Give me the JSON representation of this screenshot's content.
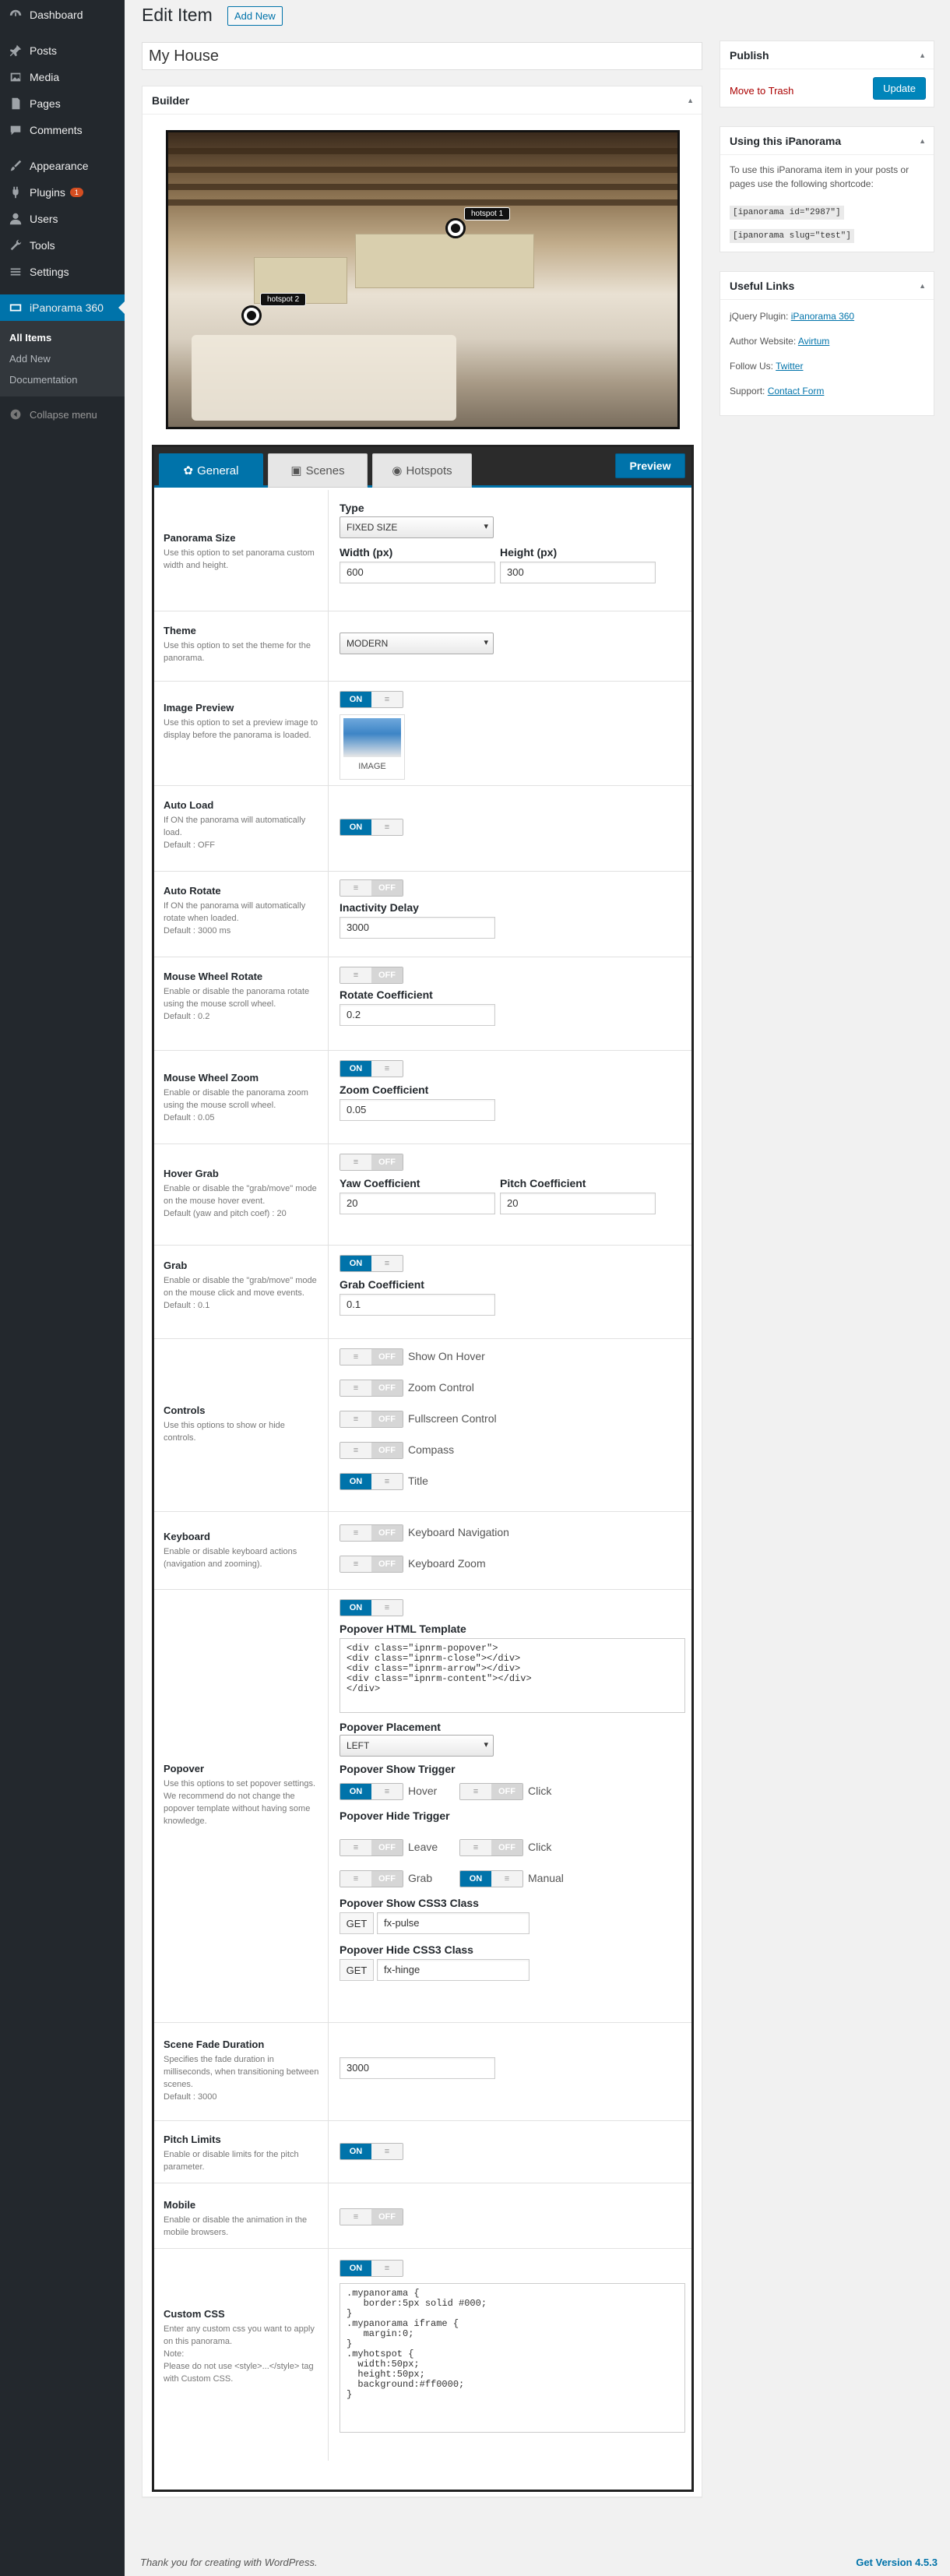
{
  "sidebar": {
    "items": [
      {
        "label": "Dashboard",
        "icon": "dashboard-icon"
      },
      {
        "label": "Posts",
        "icon": "pin-icon"
      },
      {
        "label": "Media",
        "icon": "media-icon"
      },
      {
        "label": "Pages",
        "icon": "page-icon"
      },
      {
        "label": "Comments",
        "icon": "comment-icon"
      },
      {
        "label": "Appearance",
        "icon": "brush-icon"
      },
      {
        "label": "Plugins",
        "icon": "plugin-icon",
        "badge": "1"
      },
      {
        "label": "Users",
        "icon": "user-icon"
      },
      {
        "label": "Tools",
        "icon": "wrench-icon"
      },
      {
        "label": "Settings",
        "icon": "settings-icon"
      },
      {
        "label": "iPanorama 360",
        "icon": "panorama-icon"
      }
    ],
    "submenu": [
      "All Items",
      "Add New",
      "Documentation"
    ],
    "collapse": "Collapse menu"
  },
  "header": {
    "title": "Edit Item",
    "add_new": "Add New"
  },
  "post_title": "My House",
  "builder": {
    "heading": "Builder",
    "hotspot1": "hotspot 1",
    "hotspot2": "hotspot 2",
    "tabs": [
      "General",
      "Scenes",
      "Hotspots"
    ],
    "preview": "Preview"
  },
  "settings": {
    "panorama_size": {
      "title": "Panorama Size",
      "desc": "Use this option to set panorama custom width and height.",
      "type_label": "Type",
      "type_value": "FIXED SIZE",
      "width_label": "Width (px)",
      "width_value": "600",
      "height_label": "Height (px)",
      "height_value": "300"
    },
    "theme": {
      "title": "Theme",
      "desc": "Use this option to set the theme for the panorama.",
      "value": "MODERN"
    },
    "image_preview": {
      "title": "Image Preview",
      "desc": "Use this option to set a preview image to display before the panorama is loaded.",
      "img_caption": "IMAGE"
    },
    "auto_load": {
      "title": "Auto Load",
      "desc": "If ON the panorama will automatically load.",
      "default": "Default : OFF"
    },
    "auto_rotate": {
      "title": "Auto Rotate",
      "desc": "If ON the panorama will automatically rotate when loaded.",
      "default": "Default : 3000 ms",
      "delay_label": "Inactivity Delay",
      "delay_value": "3000"
    },
    "wheel_rotate": {
      "title": "Mouse Wheel Rotate",
      "desc": "Enable or disable the panorama rotate using the mouse scroll wheel.",
      "default": "Default : 0.2",
      "coef_label": "Rotate Coefficient",
      "coef_value": "0.2"
    },
    "wheel_zoom": {
      "title": "Mouse Wheel Zoom",
      "desc": "Enable or disable the panorama zoom using the mouse scroll wheel.",
      "default": "Default : 0.05",
      "coef_label": "Zoom Coefficient",
      "coef_value": "0.05"
    },
    "hover_grab": {
      "title": "Hover Grab",
      "desc": "Enable or disable the \"grab/move\" mode on the mouse hover event.",
      "default": "Default (yaw and pitch coef) : 20",
      "yaw_label": "Yaw Coefficient",
      "yaw_value": "20",
      "pitch_label": "Pitch Coefficient",
      "pitch_value": "20"
    },
    "grab": {
      "title": "Grab",
      "desc": "Enable or disable the \"grab/move\" mode on the mouse click and move events.",
      "default": "Default : 0.1",
      "coef_label": "Grab Coefficient",
      "coef_value": "0.1"
    },
    "controls": {
      "title": "Controls",
      "desc": "Use this options to show or hide controls.",
      "items": [
        "Show On Hover",
        "Zoom Control",
        "Fullscreen Control",
        "Compass",
        "Title"
      ]
    },
    "keyboard": {
      "title": "Keyboard",
      "desc": "Enable or disable keyboard actions (navigation and zooming).",
      "items": [
        "Keyboard Navigation",
        "Keyboard Zoom"
      ]
    },
    "popover": {
      "title": "Popover",
      "desc": "Use this options to set popover settings.",
      "desc2": "We recommend do not change the popover template without having some knowledge.",
      "template_label": "Popover HTML Template",
      "template_value": "<div class=\"ipnrm-popover\">\n<div class=\"ipnrm-close\"></div>\n<div class=\"ipnrm-arrow\"></div>\n<div class=\"ipnrm-content\"></div>\n</div>",
      "placement_label": "Popover Placement",
      "placement_value": "LEFT",
      "show_trigger_label": "Popover Show Trigger",
      "hover": "Hover",
      "click": "Click",
      "hide_trigger_label": "Popover Hide Trigger",
      "leave": "Leave",
      "grab": "Grab",
      "manual": "Manual",
      "show_css_label": "Popover Show CSS3 Class",
      "show_css_value": "fx-pulse",
      "hide_css_label": "Popover Hide CSS3 Class",
      "hide_css_value": "fx-hinge",
      "get": "GET"
    },
    "fade": {
      "title": "Scene Fade Duration",
      "desc": "Specifies the fade duration in milliseconds, when transitioning between scenes.",
      "default": "Default : 3000",
      "value": "3000"
    },
    "pitch_limits": {
      "title": "Pitch Limits",
      "desc": "Enable or disable limits for the pitch parameter."
    },
    "mobile": {
      "title": "Mobile",
      "desc": "Enable or disable the animation in the mobile browsers."
    },
    "custom_css": {
      "title": "Custom CSS",
      "desc": "Enter any custom css you want to apply on this panorama.",
      "note": "Note:",
      "note2": "Please do not use <style>...</style> tag with Custom CSS.",
      "value": ".mypanorama {\n   border:5px solid #000;\n}\n.mypanorama iframe {\n   margin:0;\n}\n.myhotspot {\n  width:50px;\n  height:50px;\n  background:#ff0000;\n}"
    }
  },
  "toggles": {
    "on": "ON",
    "off": "OFF",
    "knob": "≡"
  },
  "publish": {
    "title": "Publish",
    "trash": "Move to Trash",
    "update": "Update"
  },
  "using": {
    "title": "Using this iPanorama",
    "text": "To use this iPanorama item in your posts or pages use the following shortcode:",
    "code1": "[ipanorama id=\"2987\"]",
    "code2": "[ipanorama slug=\"test\"]"
  },
  "links": {
    "title": "Useful Links",
    "jquery_label": "jQuery Plugin:",
    "jquery": "iPanorama 360",
    "author_label": "Author Website:",
    "author": "Avirtum",
    "follow_label": "Follow Us:",
    "follow": "Twitter",
    "support_label": "Support:",
    "support": "Contact Form"
  },
  "footer": {
    "thanks": "Thank you for creating with WordPress.",
    "version": "Get Version 4.5.3"
  },
  "colors": {
    "accent": "#0073aa",
    "sidebar": "#23282d",
    "danger": "#a00"
  }
}
